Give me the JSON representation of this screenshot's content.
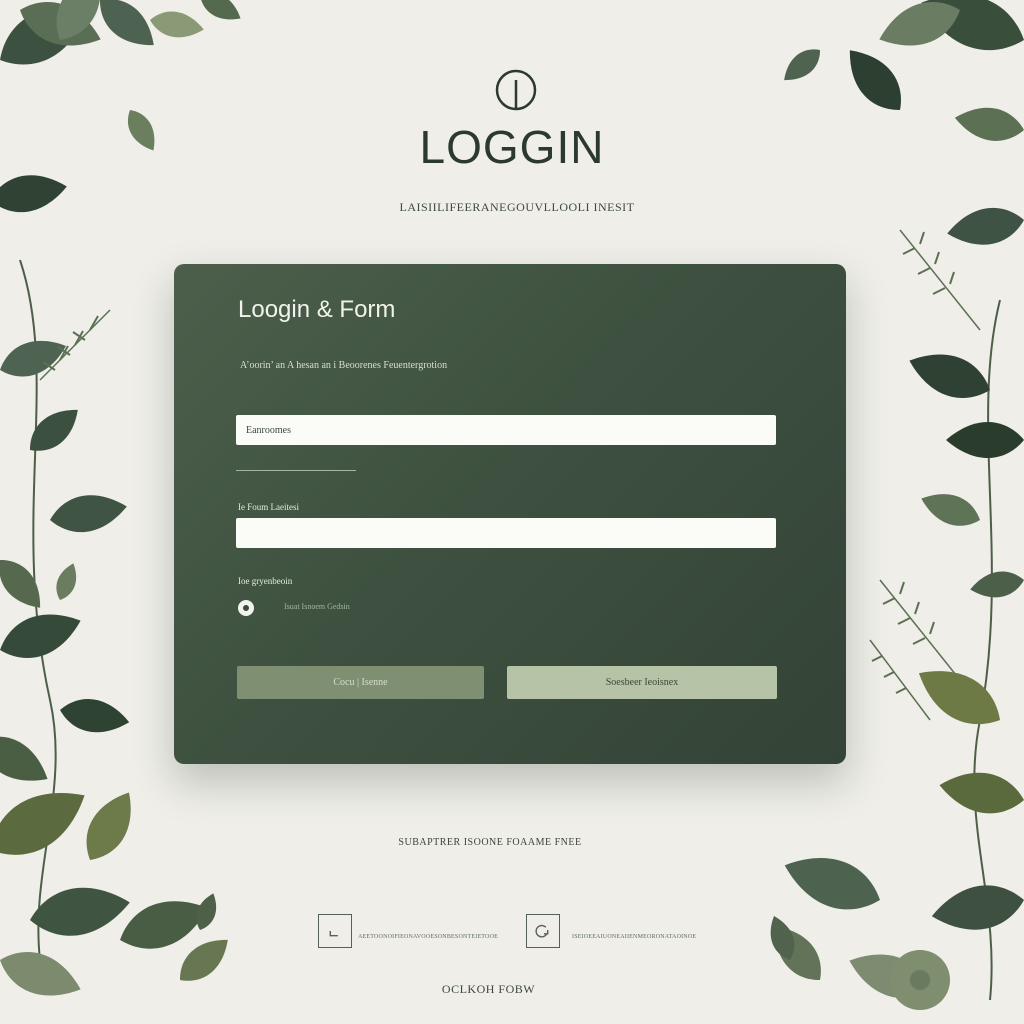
{
  "brand": {
    "title": "LOGGIN",
    "tagline": "LAISIILIFEERANEGOUVLLOOLI INESIT",
    "logo": "circle-stem-logo-icon"
  },
  "card": {
    "title": "Loogin & Form",
    "description": "A’oorin’ an A hesan an i Beoorenes Feuentergrotion",
    "username": {
      "value": "",
      "placeholder": "Eanroomes"
    },
    "password": {
      "label": "Ie Foum Laeitesi",
      "value": ""
    },
    "remember": {
      "label": "Ioe gryenbeoin",
      "text": "Isuat Isnoem Gedsin",
      "checked": true
    },
    "buttons": {
      "cancel": "Cocu | Isenne",
      "submit": "Soesbeer Ieoisnex"
    }
  },
  "footer": {
    "note": "SUBAPTRER ISOONE FOAAME FNEE",
    "social": [
      {
        "icon": "corner-arrow-icon",
        "text": "AEETOONOIFIEONAVOOESONBESONTEIETOOE"
      },
      {
        "icon": "refresh-icon",
        "text": "ISEIOEEAIUONEAIIENMEORONATAOINOE"
      }
    ],
    "bottom": "OCLKOH FOBW"
  },
  "colors": {
    "background": "#efeee9",
    "card": "#3e5140",
    "button_submit": "#b7c3a7",
    "button_cancel": "#7f8f72",
    "text_dark": "#2c3a2d"
  }
}
